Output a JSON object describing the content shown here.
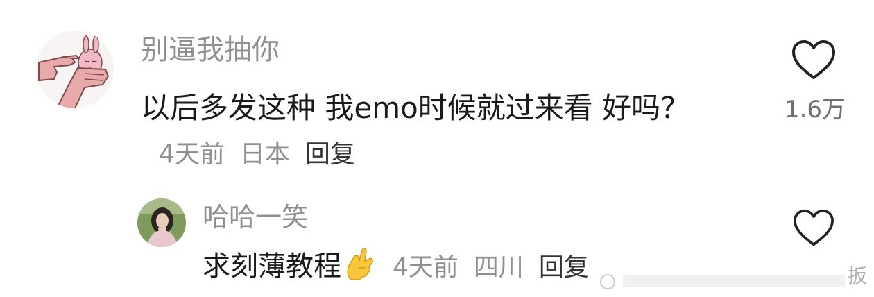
{
  "comment": {
    "username": "别逼我抽你",
    "text": "以后多发这种 我emo时候就过来看 好吗？",
    "time": "4天前",
    "location": "日本",
    "reply_label": "回复",
    "likes": "1.6万"
  },
  "reply": {
    "username": "哈哈一笑",
    "text": "求刻薄教程",
    "emoji": "finger-heart-emoji",
    "time": "4天前",
    "location": "四川",
    "reply_label": "回复"
  },
  "watermark": {
    "text": "扳"
  },
  "icons": {
    "like": "heart-outline-icon"
  },
  "colors": {
    "primary_text": "#1a1a1a",
    "secondary_text": "#8f8f8f",
    "like_count": "#6f6f6f"
  }
}
